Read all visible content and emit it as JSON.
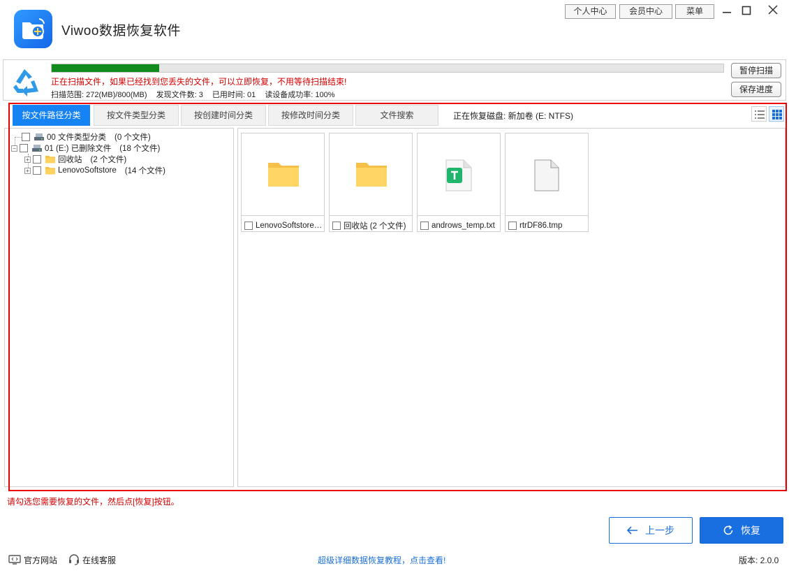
{
  "app": {
    "title": "Viwoo数据恢复软件"
  },
  "top_buttons": {
    "personal": "个人中心",
    "member": "会员中心",
    "menu": "菜单"
  },
  "scan": {
    "progress": 0.16,
    "message": "正在扫描文件，如果已经找到您丢失的文件，可以立即恢复，不用等待扫描结束!",
    "range": "扫描范围: 272(MB)/800(MB)",
    "found": "发现文件数: 3",
    "elapsed": "已用时间: 01",
    "success_rate": "读设备成功率: 100%",
    "pause_label": "暂停扫描",
    "save_label": "保存进度"
  },
  "tabs": [
    {
      "label": "按文件路径分类",
      "active": true
    },
    {
      "label": "按文件类型分类",
      "active": false
    },
    {
      "label": "按创建时间分类",
      "active": false
    },
    {
      "label": "按修改时间分类",
      "active": false
    },
    {
      "label": "文件搜索",
      "active": false
    }
  ],
  "disk_label": "正在恢复磁盘: 新加卷 (E: NTFS)",
  "tree": [
    {
      "label": "00 文件类型分类",
      "count": "(0 个文件)",
      "icon": "drive-icon"
    },
    {
      "label": "01 (E:) 已删除文件",
      "count": "(18 个文件)",
      "icon": "drive-icon"
    },
    {
      "label": "回收站",
      "count": "(2 个文件)",
      "icon": "folder-icon"
    },
    {
      "label": "LenovoSoftstore",
      "count": "(14 个文件)",
      "icon": "folder-icon"
    }
  ],
  "files": [
    {
      "name": "LenovoSoftstore ...",
      "icon": "folder-icon"
    },
    {
      "name": "回收站 (2 个文件)",
      "icon": "folder-icon"
    },
    {
      "name": "androws_temp.txt",
      "icon": "text-file-icon"
    },
    {
      "name": "rtrDF86.tmp",
      "icon": "blank-file-icon"
    }
  ],
  "hint": "请勾选您需要恢复的文件，然后点[恢复]按钮。",
  "buttons": {
    "back": "上一步",
    "recover": "恢复"
  },
  "footer": {
    "website": "官方网站",
    "support": "在线客服",
    "tutorial": "超级详细数据恢复教程，点击查看!",
    "version": "版本: 2.0.0"
  },
  "colors": {
    "accent": "#1683f5",
    "progress": "#128a1e",
    "warning": "#d40000",
    "frame": "#e60000"
  }
}
